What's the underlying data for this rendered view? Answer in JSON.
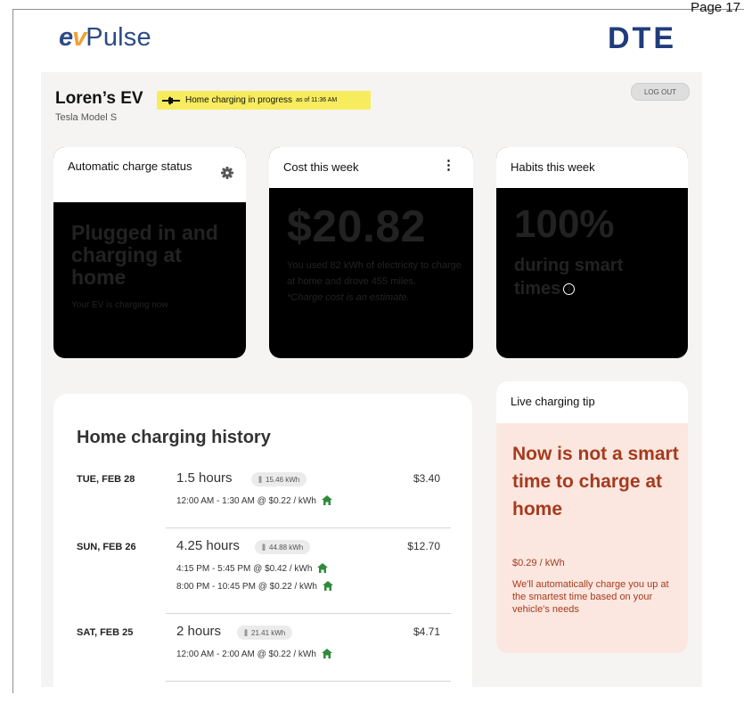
{
  "page_number": "Page 17",
  "brand": {
    "ev": "ev",
    "name": "Pulse",
    "partner": "DTE"
  },
  "vehicle": {
    "name": "Loren’s EV",
    "model": "Tesla Model S"
  },
  "status_chip": {
    "text": "Home charging in progress",
    "as_of": "as of 11:36 AM"
  },
  "logout_label": "LOG OUT",
  "cards": {
    "auto_charge": {
      "title": "Automatic charge status",
      "headline": "Plugged in and charging at home",
      "detail": "Your EV is charging now"
    },
    "cost": {
      "title": "Cost this week",
      "amount": "$20.82",
      "detail": "You used 82 kWh of electricity to charge at home and drove 455 miles.",
      "note": "*Charge cost is an estimate."
    },
    "habits": {
      "title": "Habits this week",
      "percent": "100%",
      "detail": "during smart times"
    }
  },
  "history": {
    "title": "Home charging history",
    "rows": [
      {
        "day": "TUE, FEB 28",
        "duration": "1.5 hours",
        "kwh": "15.46 kWh",
        "amount": "$3.40",
        "slots": [
          "12:00 AM - 1:30 AM @ $0.22 / kWh"
        ]
      },
      {
        "day": "SUN, FEB 26",
        "duration": "4.25 hours",
        "kwh": "44.88 kWh",
        "amount": "$12.70",
        "slots": [
          "4:15 PM - 5:45 PM @ $0.42 / kWh",
          "8:00 PM - 10:45 PM @ $0.22 / kWh"
        ]
      },
      {
        "day": "SAT, FEB 25",
        "duration": "2 hours",
        "kwh": "21.41 kWh",
        "amount": "$4.71",
        "slots": [
          "12:00 AM - 2:00 AM @ $0.22 / kWh"
        ]
      }
    ]
  },
  "tip": {
    "title": "Live charging tip",
    "headline": "Now is not a smart time to charge at home",
    "price": "$0.29 / kWh",
    "message": "We'll automatically charge you up at the smartest time based on your vehicle's needs"
  },
  "colors": {
    "brand_blue": "#2d4a86",
    "accent_orange": "#f0a030",
    "chip_yellow": "#f7ec5d",
    "tip_bg": "#fbe7df",
    "tip_text": "#a63a1f",
    "home_green": "#2e8b3a"
  },
  "icons": [
    "gear-icon",
    "kebab-menu-icon",
    "info-icon",
    "plug-icon",
    "battery-icon",
    "home-icon"
  ]
}
